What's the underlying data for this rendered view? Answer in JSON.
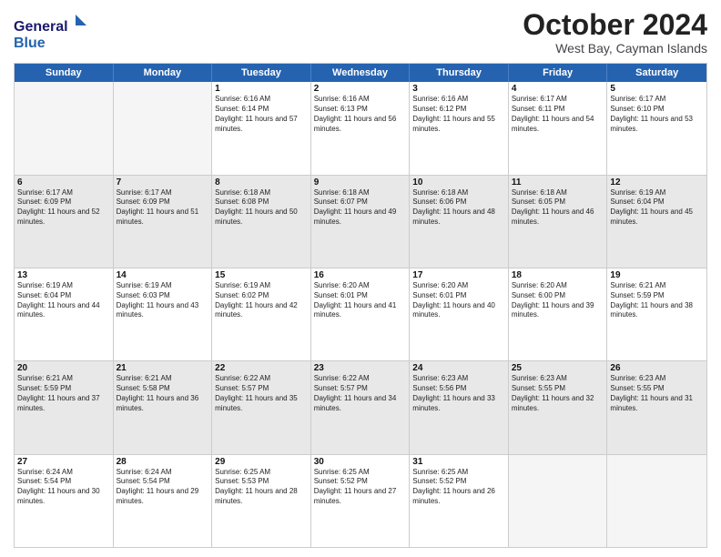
{
  "header": {
    "logo_line1": "General",
    "logo_line2": "Blue",
    "title": "October 2024",
    "location": "West Bay, Cayman Islands"
  },
  "days_of_week": [
    "Sunday",
    "Monday",
    "Tuesday",
    "Wednesday",
    "Thursday",
    "Friday",
    "Saturday"
  ],
  "weeks": [
    [
      {
        "day": "",
        "sunrise": "",
        "sunset": "",
        "daylight": ""
      },
      {
        "day": "",
        "sunrise": "",
        "sunset": "",
        "daylight": ""
      },
      {
        "day": "1",
        "sunrise": "Sunrise: 6:16 AM",
        "sunset": "Sunset: 6:14 PM",
        "daylight": "Daylight: 11 hours and 57 minutes."
      },
      {
        "day": "2",
        "sunrise": "Sunrise: 6:16 AM",
        "sunset": "Sunset: 6:13 PM",
        "daylight": "Daylight: 11 hours and 56 minutes."
      },
      {
        "day": "3",
        "sunrise": "Sunrise: 6:16 AM",
        "sunset": "Sunset: 6:12 PM",
        "daylight": "Daylight: 11 hours and 55 minutes."
      },
      {
        "day": "4",
        "sunrise": "Sunrise: 6:17 AM",
        "sunset": "Sunset: 6:11 PM",
        "daylight": "Daylight: 11 hours and 54 minutes."
      },
      {
        "day": "5",
        "sunrise": "Sunrise: 6:17 AM",
        "sunset": "Sunset: 6:10 PM",
        "daylight": "Daylight: 11 hours and 53 minutes."
      }
    ],
    [
      {
        "day": "6",
        "sunrise": "Sunrise: 6:17 AM",
        "sunset": "Sunset: 6:09 PM",
        "daylight": "Daylight: 11 hours and 52 minutes."
      },
      {
        "day": "7",
        "sunrise": "Sunrise: 6:17 AM",
        "sunset": "Sunset: 6:09 PM",
        "daylight": "Daylight: 11 hours and 51 minutes."
      },
      {
        "day": "8",
        "sunrise": "Sunrise: 6:18 AM",
        "sunset": "Sunset: 6:08 PM",
        "daylight": "Daylight: 11 hours and 50 minutes."
      },
      {
        "day": "9",
        "sunrise": "Sunrise: 6:18 AM",
        "sunset": "Sunset: 6:07 PM",
        "daylight": "Daylight: 11 hours and 49 minutes."
      },
      {
        "day": "10",
        "sunrise": "Sunrise: 6:18 AM",
        "sunset": "Sunset: 6:06 PM",
        "daylight": "Daylight: 11 hours and 48 minutes."
      },
      {
        "day": "11",
        "sunrise": "Sunrise: 6:18 AM",
        "sunset": "Sunset: 6:05 PM",
        "daylight": "Daylight: 11 hours and 46 minutes."
      },
      {
        "day": "12",
        "sunrise": "Sunrise: 6:19 AM",
        "sunset": "Sunset: 6:04 PM",
        "daylight": "Daylight: 11 hours and 45 minutes."
      }
    ],
    [
      {
        "day": "13",
        "sunrise": "Sunrise: 6:19 AM",
        "sunset": "Sunset: 6:04 PM",
        "daylight": "Daylight: 11 hours and 44 minutes."
      },
      {
        "day": "14",
        "sunrise": "Sunrise: 6:19 AM",
        "sunset": "Sunset: 6:03 PM",
        "daylight": "Daylight: 11 hours and 43 minutes."
      },
      {
        "day": "15",
        "sunrise": "Sunrise: 6:19 AM",
        "sunset": "Sunset: 6:02 PM",
        "daylight": "Daylight: 11 hours and 42 minutes."
      },
      {
        "day": "16",
        "sunrise": "Sunrise: 6:20 AM",
        "sunset": "Sunset: 6:01 PM",
        "daylight": "Daylight: 11 hours and 41 minutes."
      },
      {
        "day": "17",
        "sunrise": "Sunrise: 6:20 AM",
        "sunset": "Sunset: 6:01 PM",
        "daylight": "Daylight: 11 hours and 40 minutes."
      },
      {
        "day": "18",
        "sunrise": "Sunrise: 6:20 AM",
        "sunset": "Sunset: 6:00 PM",
        "daylight": "Daylight: 11 hours and 39 minutes."
      },
      {
        "day": "19",
        "sunrise": "Sunrise: 6:21 AM",
        "sunset": "Sunset: 5:59 PM",
        "daylight": "Daylight: 11 hours and 38 minutes."
      }
    ],
    [
      {
        "day": "20",
        "sunrise": "Sunrise: 6:21 AM",
        "sunset": "Sunset: 5:59 PM",
        "daylight": "Daylight: 11 hours and 37 minutes."
      },
      {
        "day": "21",
        "sunrise": "Sunrise: 6:21 AM",
        "sunset": "Sunset: 5:58 PM",
        "daylight": "Daylight: 11 hours and 36 minutes."
      },
      {
        "day": "22",
        "sunrise": "Sunrise: 6:22 AM",
        "sunset": "Sunset: 5:57 PM",
        "daylight": "Daylight: 11 hours and 35 minutes."
      },
      {
        "day": "23",
        "sunrise": "Sunrise: 6:22 AM",
        "sunset": "Sunset: 5:57 PM",
        "daylight": "Daylight: 11 hours and 34 minutes."
      },
      {
        "day": "24",
        "sunrise": "Sunrise: 6:23 AM",
        "sunset": "Sunset: 5:56 PM",
        "daylight": "Daylight: 11 hours and 33 minutes."
      },
      {
        "day": "25",
        "sunrise": "Sunrise: 6:23 AM",
        "sunset": "Sunset: 5:55 PM",
        "daylight": "Daylight: 11 hours and 32 minutes."
      },
      {
        "day": "26",
        "sunrise": "Sunrise: 6:23 AM",
        "sunset": "Sunset: 5:55 PM",
        "daylight": "Daylight: 11 hours and 31 minutes."
      }
    ],
    [
      {
        "day": "27",
        "sunrise": "Sunrise: 6:24 AM",
        "sunset": "Sunset: 5:54 PM",
        "daylight": "Daylight: 11 hours and 30 minutes."
      },
      {
        "day": "28",
        "sunrise": "Sunrise: 6:24 AM",
        "sunset": "Sunset: 5:54 PM",
        "daylight": "Daylight: 11 hours and 29 minutes."
      },
      {
        "day": "29",
        "sunrise": "Sunrise: 6:25 AM",
        "sunset": "Sunset: 5:53 PM",
        "daylight": "Daylight: 11 hours and 28 minutes."
      },
      {
        "day": "30",
        "sunrise": "Sunrise: 6:25 AM",
        "sunset": "Sunset: 5:52 PM",
        "daylight": "Daylight: 11 hours and 27 minutes."
      },
      {
        "day": "31",
        "sunrise": "Sunrise: 6:25 AM",
        "sunset": "Sunset: 5:52 PM",
        "daylight": "Daylight: 11 hours and 26 minutes."
      },
      {
        "day": "",
        "sunrise": "",
        "sunset": "",
        "daylight": ""
      },
      {
        "day": "",
        "sunrise": "",
        "sunset": "",
        "daylight": ""
      }
    ]
  ]
}
